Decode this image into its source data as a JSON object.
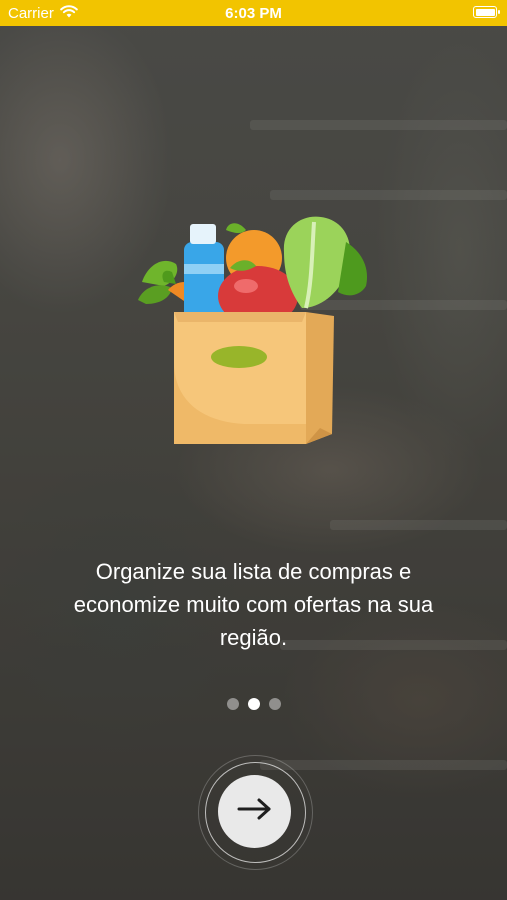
{
  "status_bar": {
    "carrier": "Carrier",
    "time": "6:03 PM",
    "battery_level": 1.0,
    "background_color": "#f2c400"
  },
  "onboarding": {
    "illustration": "grocery-bag-icon",
    "tagline": "Organize sua lista de compras e economize muito com ofertas na sua região.",
    "page_count": 3,
    "active_page": 2,
    "next_button_icon": "arrow-right-icon"
  }
}
